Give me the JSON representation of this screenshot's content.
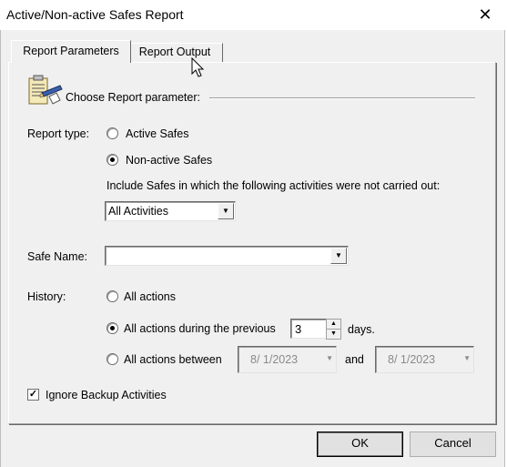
{
  "window": {
    "title": "Active/Non-active Safes Report"
  },
  "tabs": [
    {
      "label": "Report Parameters",
      "active": true
    },
    {
      "label": "Report Output",
      "active": false
    }
  ],
  "section": {
    "heading": "Choose Report parameter:"
  },
  "report_type": {
    "label": "Report type:",
    "options": [
      "Active Safes",
      "Non-active Safes"
    ],
    "selected": "Non-active Safes"
  },
  "include_text": "Include Safes in which the following activities were not carried out:",
  "activities_select": {
    "value": "All Activities"
  },
  "safe_name": {
    "label": "Safe Name:",
    "value": ""
  },
  "history": {
    "label": "History:",
    "opt_all": "All actions",
    "opt_previous": "All actions during the previous",
    "previous_value": "3",
    "days_label": "days.",
    "opt_between": "All actions between",
    "date_from": "8/ 1/2023",
    "and_label": "and",
    "date_to": "8/ 1/2023",
    "selected": "All actions during the previous"
  },
  "ignore_backup": {
    "label": "Ignore Backup Activities",
    "checked": true
  },
  "buttons": {
    "ok": "OK",
    "cancel": "Cancel"
  }
}
